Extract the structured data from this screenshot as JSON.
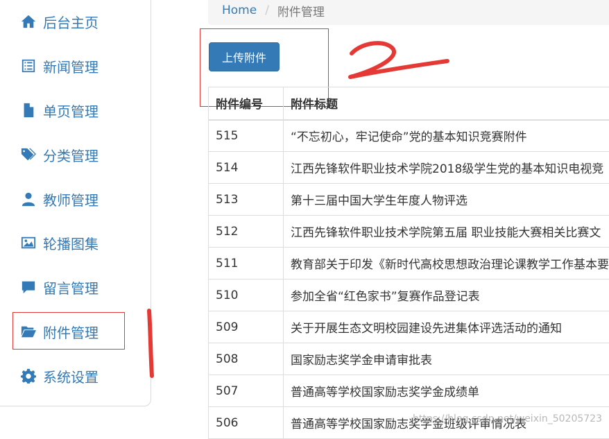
{
  "sidebar": {
    "items": [
      {
        "label": "后台主页",
        "icon": "home-icon"
      },
      {
        "label": "新闻管理",
        "icon": "list-icon"
      },
      {
        "label": "单页管理",
        "icon": "file-icon"
      },
      {
        "label": "分类管理",
        "icon": "tags-icon"
      },
      {
        "label": "教师管理",
        "icon": "user-icon"
      },
      {
        "label": "轮播图集",
        "icon": "picture-icon"
      },
      {
        "label": "留言管理",
        "icon": "comment-icon"
      },
      {
        "label": "附件管理",
        "icon": "folder-open-icon"
      },
      {
        "label": "系统设置",
        "icon": "gear-icon"
      }
    ],
    "active": "附件管理"
  },
  "breadcrumb": {
    "home": "Home",
    "separator": "/",
    "current": "附件管理"
  },
  "toolbar": {
    "upload_label": "上传附件"
  },
  "table": {
    "headers": [
      "附件编号",
      "附件标题"
    ],
    "rows": [
      [
        "515",
        "“不忘初心，牢记使命”党的基本知识竞赛附件"
      ],
      [
        "514",
        "江西先锋软件职业技术学院2018级学生党的基本知识电视竞"
      ],
      [
        "513",
        "第十三届中国大学生年度人物评选"
      ],
      [
        "512",
        "江西先锋软件职业技术学院第五届 职业技能大赛相关比赛文"
      ],
      [
        "511",
        "教育部关于印发《新时代高校思想政治理论课教学工作基本要"
      ],
      [
        "510",
        "参加全省“红色家书”复赛作品登记表"
      ],
      [
        "509",
        "关于开展生态文明校园建设先进集体评选活动的通知"
      ],
      [
        "508",
        "国家励志奖学金申请审批表"
      ],
      [
        "507",
        "普通高等学校国家励志奖学金成绩单"
      ],
      [
        "506",
        "普通高等学校国家励志奖学金班级评审情况表"
      ]
    ]
  },
  "watermark": "https://blog.csdn.net/weixin_50205723",
  "colors": {
    "link": "#337ab7",
    "button": "#337ab7",
    "annotation": "#e53935"
  }
}
